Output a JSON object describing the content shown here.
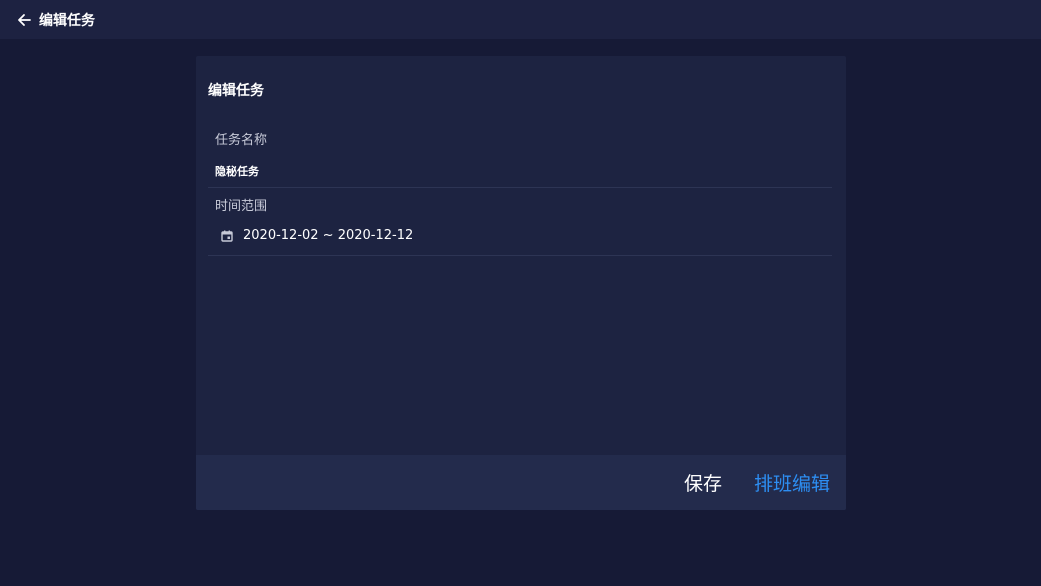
{
  "header": {
    "title": "编辑任务",
    "back_icon": "arrow-left-icon"
  },
  "form": {
    "title": "编辑任务",
    "task_name": {
      "label": "任务名称",
      "value": "隐秘任务"
    },
    "time_range": {
      "label": "时间范围",
      "icon": "calendar-icon",
      "value": "2020-12-02 ~ 2020-12-12"
    }
  },
  "footer": {
    "save_label": "保存",
    "schedule_edit_label": "排班编辑"
  },
  "colors": {
    "background": "#161a36",
    "topbar": "#1d2241",
    "card": "#1d2341",
    "footer": "#232b4c",
    "accent": "#2d8ef2"
  }
}
